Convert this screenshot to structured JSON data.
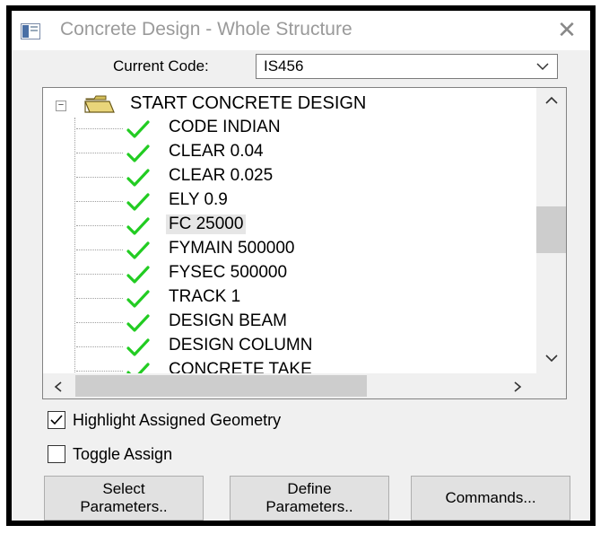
{
  "window": {
    "title": "Concrete Design - Whole Structure",
    "close_glyph": "✕"
  },
  "code": {
    "label": "Current Code:",
    "value": "IS456"
  },
  "tree": {
    "root": {
      "label": "START CONCRETE DESIGN",
      "expander": "−",
      "icon": "folder-open-icon"
    },
    "items": [
      {
        "label": "CODE INDIAN",
        "icon": "check-icon"
      },
      {
        "label": "CLEAR 0.04",
        "icon": "check-icon"
      },
      {
        "label": "CLEAR 0.025",
        "icon": "check-icon"
      },
      {
        "label": "ELY 0.9",
        "icon": "check-icon"
      },
      {
        "label": "FC 25000",
        "icon": "check-icon",
        "selected": true
      },
      {
        "label": "FYMAIN 500000",
        "icon": "check-icon"
      },
      {
        "label": "FYSEC 500000",
        "icon": "check-icon"
      },
      {
        "label": "TRACK 1",
        "icon": "check-icon"
      },
      {
        "label": "DESIGN BEAM",
        "icon": "check-icon"
      },
      {
        "label": "DESIGN COLUMN",
        "icon": "check-icon"
      },
      {
        "label": "CONCRETE TAKE",
        "icon": "check-icon"
      }
    ]
  },
  "options": {
    "highlight": {
      "label": "Highlight Assigned Geometry",
      "checked": true
    },
    "toggle": {
      "label": "Toggle Assign",
      "checked": false
    }
  },
  "buttons": {
    "select": {
      "line1": "Select",
      "line2": "Parameters.."
    },
    "define": {
      "line1": "Define",
      "line2": "Parameters.."
    },
    "commands": {
      "label": "Commands..."
    }
  },
  "colors": {
    "check": "#22cc22",
    "folder": "#e9d57a"
  }
}
